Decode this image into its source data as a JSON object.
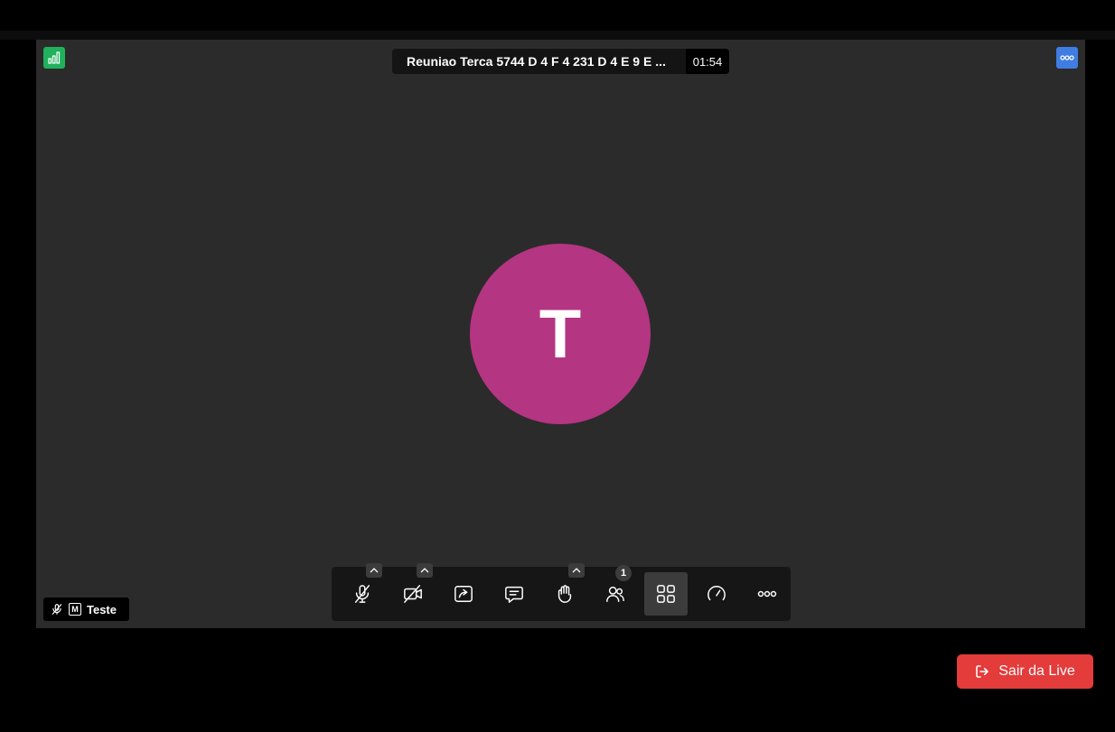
{
  "meeting": {
    "title": "Reuniao Terca 5744 D 4 F 4 231 D 4 E 9 E ...",
    "timer": "01:54"
  },
  "participant": {
    "initial": "T",
    "name": "Teste",
    "avatar_color": "#b43582"
  },
  "name_tag": {
    "moderator_badge": "M"
  },
  "toolbar": {
    "buttons": [
      {
        "icon": "microphone-muted-icon",
        "has_caret": true
      },
      {
        "icon": "camera-off-icon",
        "has_caret": true
      },
      {
        "icon": "screen-share-icon"
      },
      {
        "icon": "chat-icon"
      },
      {
        "icon": "raise-hand-icon",
        "has_caret": true
      },
      {
        "icon": "participants-icon",
        "badge": "1"
      },
      {
        "icon": "tile-view-icon",
        "active": true
      },
      {
        "icon": "performance-gauge-icon"
      },
      {
        "icon": "more-options-icon"
      }
    ]
  },
  "leave": {
    "label": "Sair da Live",
    "color": "#e43b3b"
  },
  "colors": {
    "stats_button": "#21b15d",
    "more_button": "#3f7de3",
    "stage_bg": "#2b2b2b"
  }
}
